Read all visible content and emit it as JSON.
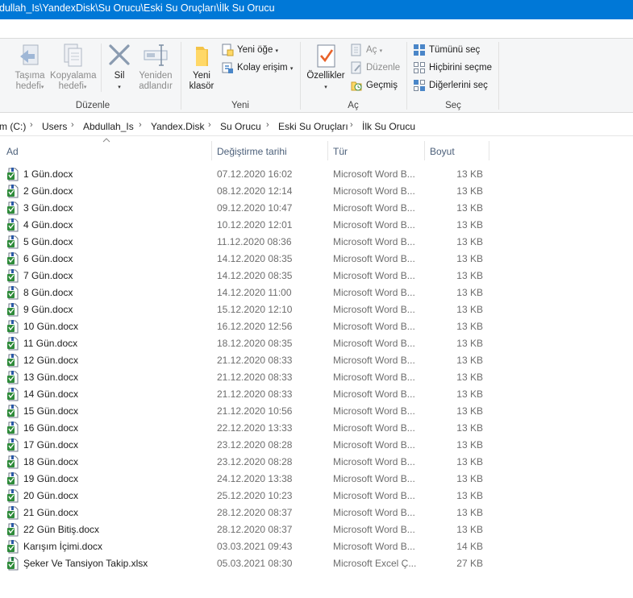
{
  "window": {
    "title_path": "dullah_Is\\YandexDisk\\Su Orucu\\Eski Su Oruçları\\İlk Su Orucu"
  },
  "ribbon": {
    "groups": {
      "duzenle": {
        "label": "Düzenle",
        "move_to": [
          "Taşıma",
          "hedefi"
        ],
        "copy_to": [
          "Kopyalama",
          "hedefi"
        ],
        "delete": "Sil",
        "rename": [
          "Yeniden",
          "adlandır"
        ]
      },
      "yeni": {
        "label": "Yeni",
        "new_folder": [
          "Yeni",
          "klasör"
        ],
        "new_item": "Yeni öğe",
        "easy_access": "Kolay erişim"
      },
      "ac": {
        "label": "Aç",
        "properties": "Özellikler",
        "open": "Aç",
        "edit": "Düzenle",
        "history": "Geçmiş"
      },
      "sec": {
        "label": "Seç",
        "select_all": "Tümünü seç",
        "select_none": "Hiçbirini seçme",
        "invert_selection": "Diğerlerini seç"
      }
    }
  },
  "address": {
    "crumbs": [
      "m (C:)",
      "Users",
      "Abdullah_Is",
      "Yandex.Disk",
      "Su Orucu",
      "Eski Su Oruçları",
      "İlk Su Orucu"
    ]
  },
  "columns": {
    "name": "Ad",
    "date": "Değiştirme tarihi",
    "type": "Tür",
    "size": "Boyut"
  },
  "colors": {
    "title_bar": "#0078d7",
    "word_icon_green": "#2e8b3a",
    "header_text": "#4c607a"
  },
  "files": [
    {
      "name": "1 Gün.docx",
      "date": "07.12.2020 16:02",
      "type": "Microsoft Word B...",
      "size": "13 KB",
      "icon": "word-doc-icon"
    },
    {
      "name": "2 Gün.docx",
      "date": "08.12.2020 12:14",
      "type": "Microsoft Word B...",
      "size": "13 KB",
      "icon": "word-doc-icon"
    },
    {
      "name": "3 Gün.docx",
      "date": "09.12.2020 10:47",
      "type": "Microsoft Word B...",
      "size": "13 KB",
      "icon": "word-doc-icon"
    },
    {
      "name": "4 Gün.docx",
      "date": "10.12.2020 12:01",
      "type": "Microsoft Word B...",
      "size": "13 KB",
      "icon": "word-doc-icon"
    },
    {
      "name": "5 Gün.docx",
      "date": "11.12.2020 08:36",
      "type": "Microsoft Word B...",
      "size": "13 KB",
      "icon": "word-doc-icon"
    },
    {
      "name": "6 Gün.docx",
      "date": "14.12.2020 08:35",
      "type": "Microsoft Word B...",
      "size": "13 KB",
      "icon": "word-doc-icon"
    },
    {
      "name": "7 Gün.docx",
      "date": "14.12.2020 08:35",
      "type": "Microsoft Word B...",
      "size": "13 KB",
      "icon": "word-doc-icon"
    },
    {
      "name": "8 Gün.docx",
      "date": "14.12.2020 11:00",
      "type": "Microsoft Word B...",
      "size": "13 KB",
      "icon": "word-doc-icon"
    },
    {
      "name": "9 Gün.docx",
      "date": "15.12.2020 12:10",
      "type": "Microsoft Word B...",
      "size": "13 KB",
      "icon": "word-doc-icon"
    },
    {
      "name": "10 Gün.docx",
      "date": "16.12.2020 12:56",
      "type": "Microsoft Word B...",
      "size": "13 KB",
      "icon": "word-doc-icon"
    },
    {
      "name": "11 Gün.docx",
      "date": "18.12.2020 08:35",
      "type": "Microsoft Word B...",
      "size": "13 KB",
      "icon": "word-doc-icon"
    },
    {
      "name": "12 Gün.docx",
      "date": "21.12.2020 08:33",
      "type": "Microsoft Word B...",
      "size": "13 KB",
      "icon": "word-doc-icon"
    },
    {
      "name": "13 Gün.docx",
      "date": "21.12.2020 08:33",
      "type": "Microsoft Word B...",
      "size": "13 KB",
      "icon": "word-doc-icon"
    },
    {
      "name": "14 Gün.docx",
      "date": "21.12.2020 08:33",
      "type": "Microsoft Word B...",
      "size": "13 KB",
      "icon": "word-doc-icon"
    },
    {
      "name": "15 Gün.docx",
      "date": "21.12.2020 10:56",
      "type": "Microsoft Word B...",
      "size": "13 KB",
      "icon": "word-doc-icon"
    },
    {
      "name": "16 Gün.docx",
      "date": "22.12.2020 13:33",
      "type": "Microsoft Word B...",
      "size": "13 KB",
      "icon": "word-doc-icon"
    },
    {
      "name": "17 Gün.docx",
      "date": "23.12.2020 08:28",
      "type": "Microsoft Word B...",
      "size": "13 KB",
      "icon": "word-doc-icon"
    },
    {
      "name": "18 Gün.docx",
      "date": "23.12.2020 08:28",
      "type": "Microsoft Word B...",
      "size": "13 KB",
      "icon": "word-doc-icon"
    },
    {
      "name": "19 Gün.docx",
      "date": "24.12.2020 13:38",
      "type": "Microsoft Word B...",
      "size": "13 KB",
      "icon": "word-doc-icon"
    },
    {
      "name": "20 Gün.docx",
      "date": "25.12.2020 10:23",
      "type": "Microsoft Word B...",
      "size": "13 KB",
      "icon": "word-doc-icon"
    },
    {
      "name": "21 Gün.docx",
      "date": "28.12.2020 08:37",
      "type": "Microsoft Word B...",
      "size": "13 KB",
      "icon": "word-doc-icon"
    },
    {
      "name": "22 Gün Bitiş.docx",
      "date": "28.12.2020 08:37",
      "type": "Microsoft Word B...",
      "size": "13 KB",
      "icon": "word-doc-icon"
    },
    {
      "name": "Karışım İçimi.docx",
      "date": "03.03.2021 09:43",
      "type": "Microsoft Word B...",
      "size": "14 KB",
      "icon": "word-doc-icon"
    },
    {
      "name": "Şeker Ve Tansiyon Takip.xlsx",
      "date": "05.03.2021 08:30",
      "type": "Microsoft Excel Ç...",
      "size": "27 KB",
      "icon": "excel-doc-icon"
    }
  ]
}
